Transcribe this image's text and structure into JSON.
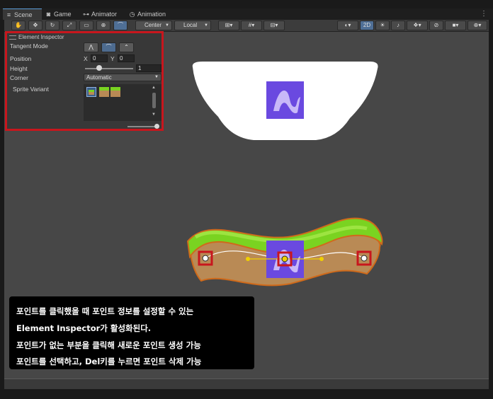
{
  "tabs": [
    {
      "label": "Scene",
      "icon": "grid-icon",
      "active": true
    },
    {
      "label": "Game",
      "icon": "gamepad-icon",
      "active": false
    },
    {
      "label": "Animator",
      "icon": "animator-icon",
      "active": false
    },
    {
      "label": "Animation",
      "icon": "clock-icon",
      "active": false
    }
  ],
  "toolbar": {
    "pivot_label": "Center",
    "space_label": "Local",
    "mode_2d_label": "2D"
  },
  "inspector": {
    "title": "Element Inspector",
    "tangent_mode_label": "Tangent Mode",
    "position_label": "Position",
    "pos_x_label": "X",
    "pos_x_value": "0",
    "pos_y_label": "Y",
    "pos_y_value": "0",
    "height_label": "Height",
    "height_value": "1",
    "height_slider_fraction": 0.3,
    "corner_label": "Corner",
    "corner_value": "Automatic",
    "sprite_variant_label": "Sprite Variant"
  },
  "caption": {
    "line1": "포인트를 클릭했을 때 포인트 정보를 설정할 수 있는",
    "line2": "Element Inspector가 활성화된다.",
    "line3": "포인트가 없는 부분을 클릭해 새로운 포인트 생성 가능",
    "line4": "포인트를 선택하고, Del키를 누르면 포인트 삭제 가능"
  },
  "colors": {
    "highlight_red": "#c8161d",
    "grass_green": "#7ad321",
    "dirt_brown": "#b98a55",
    "sprite_purple": "#6a49e0",
    "active_blue": "#4f6f96"
  }
}
